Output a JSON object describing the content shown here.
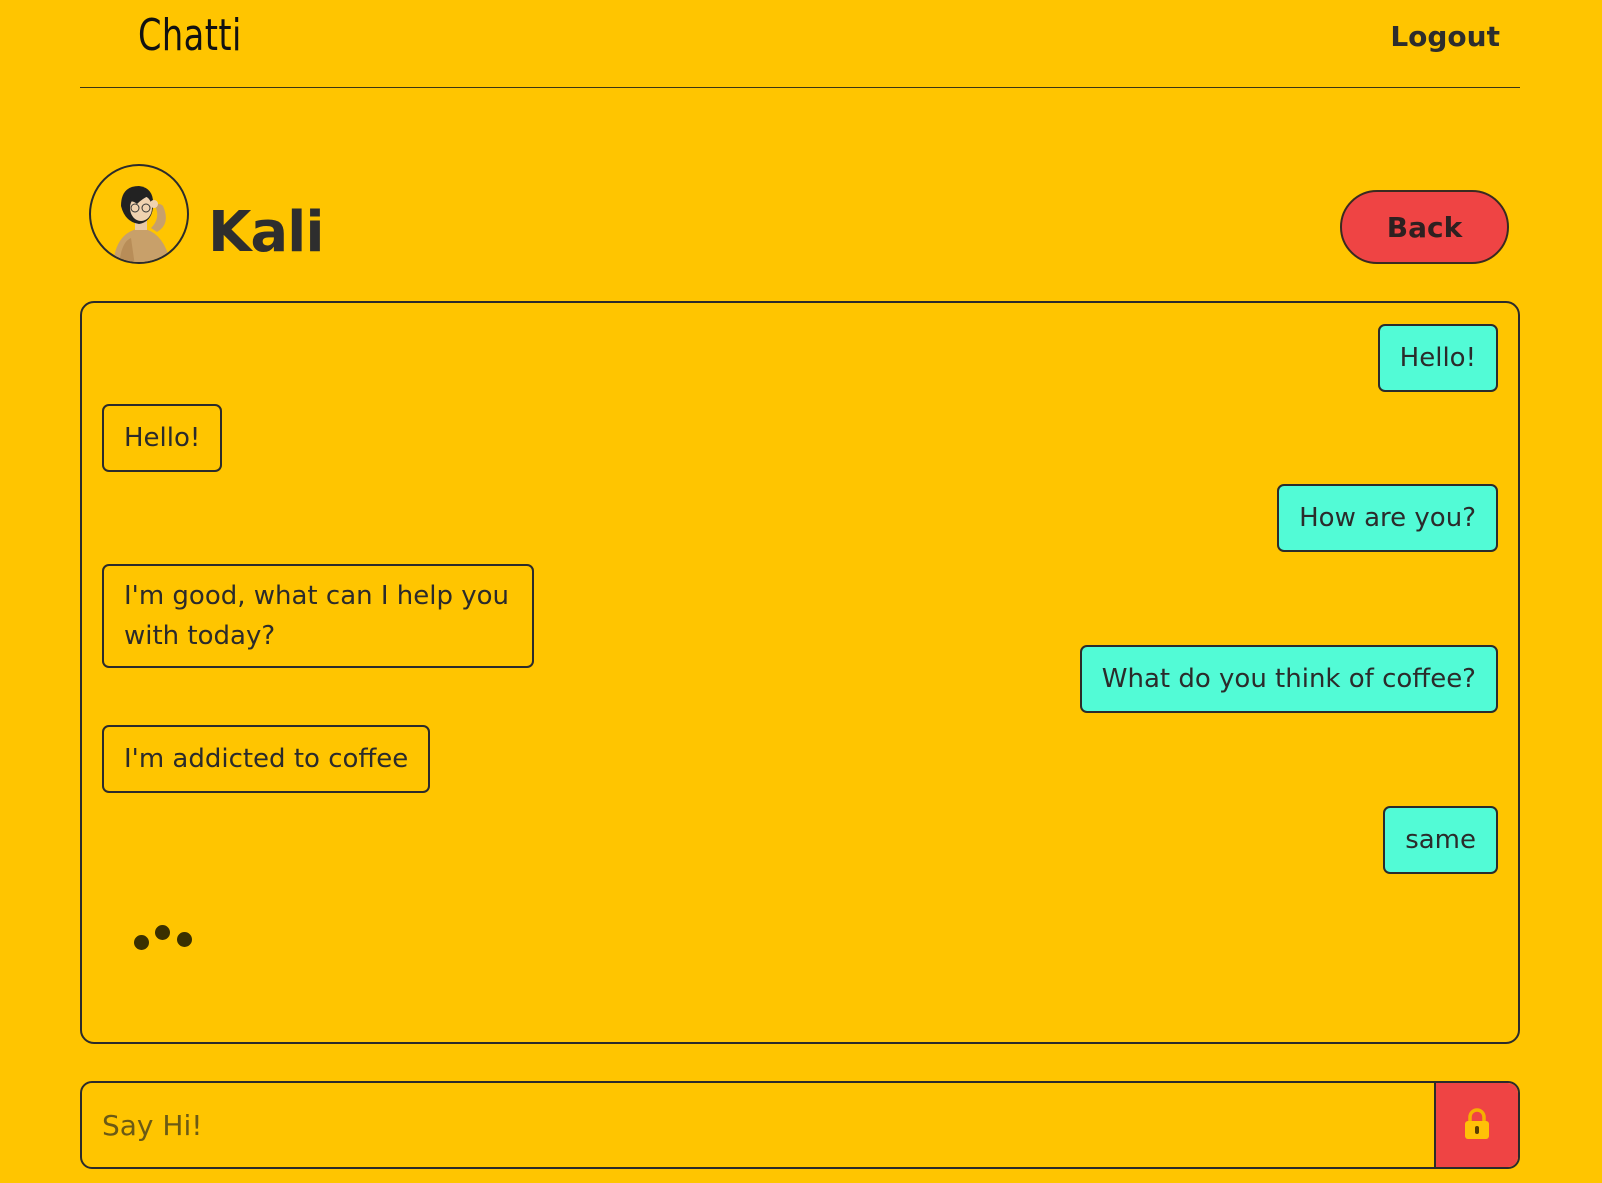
{
  "header": {
    "brand": "Chatti",
    "logout_label": "Logout"
  },
  "profile": {
    "name": "Kali",
    "back_label": "Back"
  },
  "messages": [
    {
      "from": "user",
      "text": "Hello!"
    },
    {
      "from": "bot",
      "text": "Hello!"
    },
    {
      "from": "user",
      "text": "How are you?"
    },
    {
      "from": "bot",
      "text": "I'm good, what can I help you with today?"
    },
    {
      "from": "user",
      "text": "What do you think of coffee?"
    },
    {
      "from": "bot",
      "text": "I'm addicted to coffee"
    },
    {
      "from": "user",
      "text": "same"
    }
  ],
  "composer": {
    "placeholder": "Say Hi!",
    "value": ""
  },
  "colors": {
    "background": "#ffc500",
    "user_bubble": "#52fbd6",
    "accent_red": "#ef4444",
    "border": "#2b2b2b"
  },
  "icons": {
    "send": "lock-icon",
    "typing": "typing-dots-icon"
  }
}
